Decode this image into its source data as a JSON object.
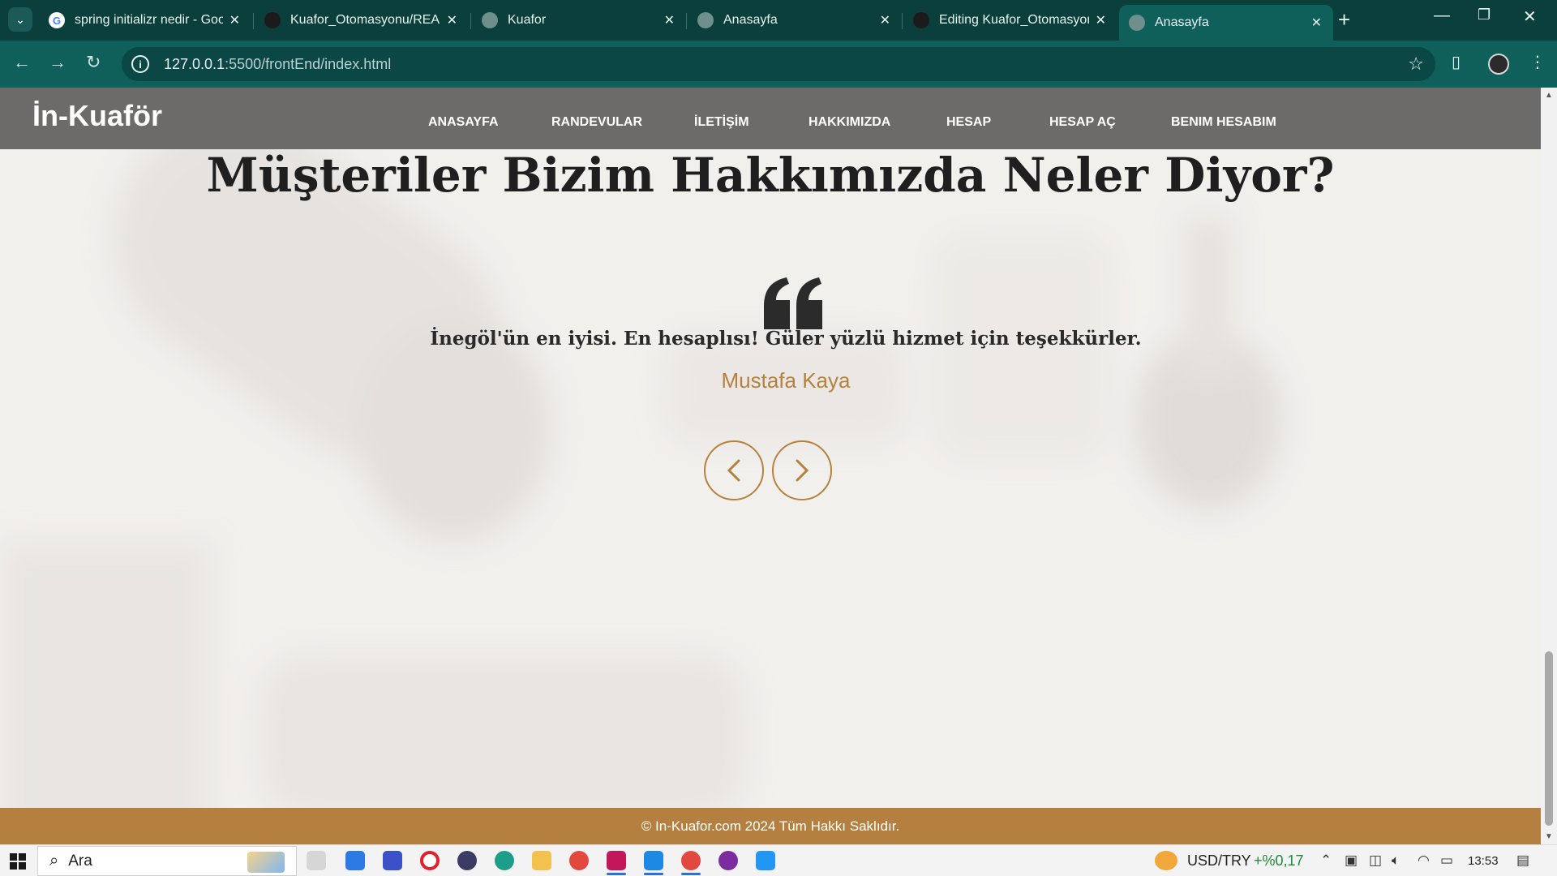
{
  "browser": {
    "tabs": [
      {
        "title": "spring initializr nedir - Goo",
        "icon": "google-icon",
        "active": false
      },
      {
        "title": "Kuafor_Otomasyonu/READ",
        "icon": "github-icon",
        "active": false
      },
      {
        "title": "Kuafor",
        "icon": "globe-icon",
        "active": false
      },
      {
        "title": "Anasayfa",
        "icon": "globe-icon",
        "active": false
      },
      {
        "title": "Editing Kuafor_Otomasyon",
        "icon": "github-icon",
        "active": false
      },
      {
        "title": "Anasayfa",
        "icon": "globe-icon",
        "active": true
      }
    ],
    "tab_close": "✕",
    "new_tab": "+",
    "url_host": "127.0.0.1",
    "url_path": ":5500/frontEnd/index.html",
    "colors": {
      "frame": "#0a3f3c",
      "toolbar": "#0f5f5b"
    }
  },
  "site": {
    "logo": "İn-Kuaför",
    "nav": [
      "ANASAYFA",
      "RANDEVULAR",
      "İLETİŞİM",
      "HAKKIMIZDA",
      "HESAP",
      "HESAP AÇ",
      "BENIM HESABIM"
    ],
    "testimonials": {
      "heading": "Müşteriler Bizim Hakkımızda Neler Diyor?",
      "quote": "İnegöl'ün en iyisi. En hesaplısı! Güler yüzlü hizmet için teşekkürler.",
      "author": "Mustafa Kaya",
      "prev_icon": "chevron-left-icon",
      "next_icon": "chevron-right-icon"
    },
    "footer": "© In-Kuafor.com 2024 Tüm Hakkı Saklıdır.",
    "colors": {
      "accent": "#b5803f",
      "navbar": "#6d6b69",
      "heading": "#1f1f1f"
    }
  },
  "taskbar": {
    "search_placeholder": "Ara",
    "ticker_label": "USD/TRY",
    "ticker_value": "+%0,17",
    "time": "13:53",
    "ticker_color": "#1f8a3a"
  }
}
